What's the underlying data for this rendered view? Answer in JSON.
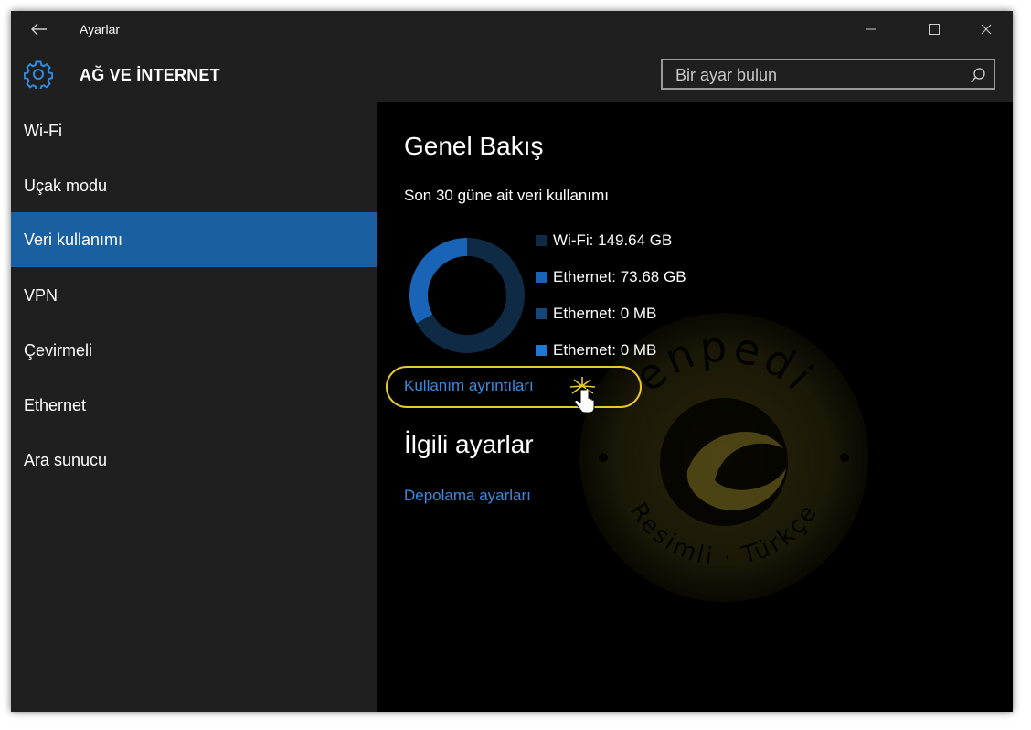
{
  "window": {
    "title": "Ayarlar",
    "section_title": "AĞ VE İNTERNET"
  },
  "search": {
    "placeholder": "Bir ayar bulun",
    "icon": "search-icon"
  },
  "sidebar": {
    "items": [
      {
        "label": "Wi-Fi",
        "active": false
      },
      {
        "label": "Uçak modu",
        "active": false
      },
      {
        "label": "Veri kullanımı",
        "active": true
      },
      {
        "label": "VPN",
        "active": false
      },
      {
        "label": "Çevirmeli",
        "active": false
      },
      {
        "label": "Ethernet",
        "active": false
      },
      {
        "label": "Ara sunucu",
        "active": false
      }
    ]
  },
  "overview": {
    "title": "Genel Bakış",
    "period": "Son 30 güne ait veri kullanımı",
    "legend": [
      {
        "label": "Wi-Fi: 149.64 GB",
        "value_gb": 149.64,
        "color": "#0f2a44"
      },
      {
        "label": "Ethernet: 73.68 GB",
        "value_gb": 73.68,
        "color": "#1a64b8"
      },
      {
        "label": "Ethernet: 0 MB",
        "value_gb": 0,
        "color": "#15467a"
      },
      {
        "label": "Ethernet: 0 MB",
        "value_gb": 0,
        "color": "#1a7ad4"
      }
    ],
    "details_link": "Kullanım ayrıntıları"
  },
  "related": {
    "title": "İlgili ayarlar",
    "storage_link": "Depolama ayarları"
  },
  "watermark": {
    "top_text": "enpedi",
    "bottom_text": "Resimli · Türkçe"
  },
  "colors": {
    "accent": "#1a5fa0",
    "link": "#3a8be0",
    "highlight": "#e8c830"
  }
}
